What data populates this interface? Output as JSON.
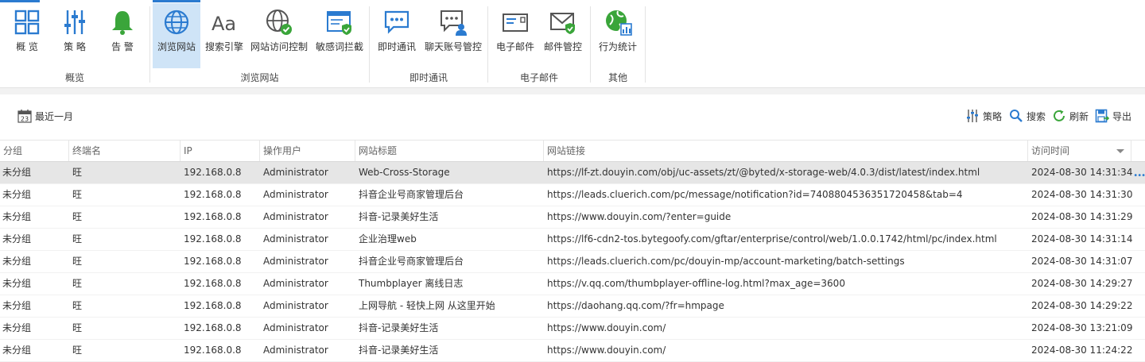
{
  "ribbon": {
    "groups": [
      {
        "label": "概览",
        "buttons": [
          {
            "label": "概 览",
            "icon": "dashboard-icon"
          },
          {
            "label": "策 略",
            "icon": "sliders-icon"
          },
          {
            "label": "告 警",
            "icon": "bell-icon"
          }
        ]
      },
      {
        "label": "浏览网站",
        "buttons": [
          {
            "label": "浏览网站",
            "icon": "globe-icon",
            "active": true
          },
          {
            "label": "搜索引擎",
            "icon": "font-aa-icon"
          },
          {
            "label": "网站访问控制",
            "icon": "globe-check-icon"
          },
          {
            "label": "敏感词拦截",
            "icon": "window-shield-icon"
          }
        ]
      },
      {
        "label": "即时通讯",
        "buttons": [
          {
            "label": "即时通讯",
            "icon": "chat-bubble-icon"
          },
          {
            "label": "聊天账号管控",
            "icon": "chat-user-icon"
          }
        ]
      },
      {
        "label": "电子邮件",
        "buttons": [
          {
            "label": "电子邮件",
            "icon": "email-icon"
          },
          {
            "label": "邮件管控",
            "icon": "email-shield-icon"
          }
        ]
      },
      {
        "label": "其他",
        "buttons": [
          {
            "label": "行为统计",
            "icon": "stats-globe-icon"
          }
        ]
      }
    ]
  },
  "toolbar": {
    "date_range": "最近一月",
    "calendar_day": "23",
    "policy": "策略",
    "search": "搜索",
    "refresh": "刷新",
    "export": "导出"
  },
  "table": {
    "columns": [
      "分组",
      "终端名",
      "IP",
      "操作用户",
      "网站标题",
      "网站链接",
      "访问时间"
    ],
    "rows": [
      [
        "未分组",
        "旺",
        "192.168.0.8",
        "Administrator",
        "Web-Cross-Storage",
        "https://lf-zt.douyin.com/obj/uc-assets/zt/@byted/x-storage-web/4.0.3/dist/latest/index.html",
        "2024-08-30 14:31:34"
      ],
      [
        "未分组",
        "旺",
        "192.168.0.8",
        "Administrator",
        "抖音企业号商家管理后台",
        "https://leads.cluerich.com/pc/message/notification?id=7408804536351720458&tab=4",
        "2024-08-30 14:31:30"
      ],
      [
        "未分组",
        "旺",
        "192.168.0.8",
        "Administrator",
        "抖音-记录美好生活",
        "https://www.douyin.com/?enter=guide",
        "2024-08-30 14:31:29"
      ],
      [
        "未分组",
        "旺",
        "192.168.0.8",
        "Administrator",
        "企业治理web",
        "https://lf6-cdn2-tos.bytegoofy.com/gftar/enterprise/control/web/1.0.0.1742/html/pc/index.html",
        "2024-08-30 14:31:14"
      ],
      [
        "未分组",
        "旺",
        "192.168.0.8",
        "Administrator",
        "抖音企业号商家管理后台",
        "https://leads.cluerich.com/pc/douyin-mp/account-marketing/batch-settings",
        "2024-08-30 14:31:07"
      ],
      [
        "未分组",
        "旺",
        "192.168.0.8",
        "Administrator",
        "Thumbplayer 离线日志",
        "https://v.qq.com/thumbplayer-offline-log.html?max_age=3600",
        "2024-08-30 14:29:27"
      ],
      [
        "未分组",
        "旺",
        "192.168.0.8",
        "Administrator",
        "上网导航 - 轻快上网 从这里开始",
        "https://daohang.qq.com/?fr=hmpage",
        "2024-08-30 14:29:22"
      ],
      [
        "未分组",
        "旺",
        "192.168.0.8",
        "Administrator",
        "抖音-记录美好生活",
        "https://www.douyin.com/",
        "2024-08-30 13:21:09"
      ],
      [
        "未分组",
        "旺",
        "192.168.0.8",
        "Administrator",
        "抖音-记录美好生活",
        "https://www.douyin.com/",
        "2024-08-30 11:24:22"
      ]
    ],
    "more_label": "•••"
  },
  "colors": {
    "accent": "#2b7bd0",
    "green": "#3aa53a",
    "selected_row": "#e6e6e6",
    "active_button": "#cfe4f7"
  }
}
